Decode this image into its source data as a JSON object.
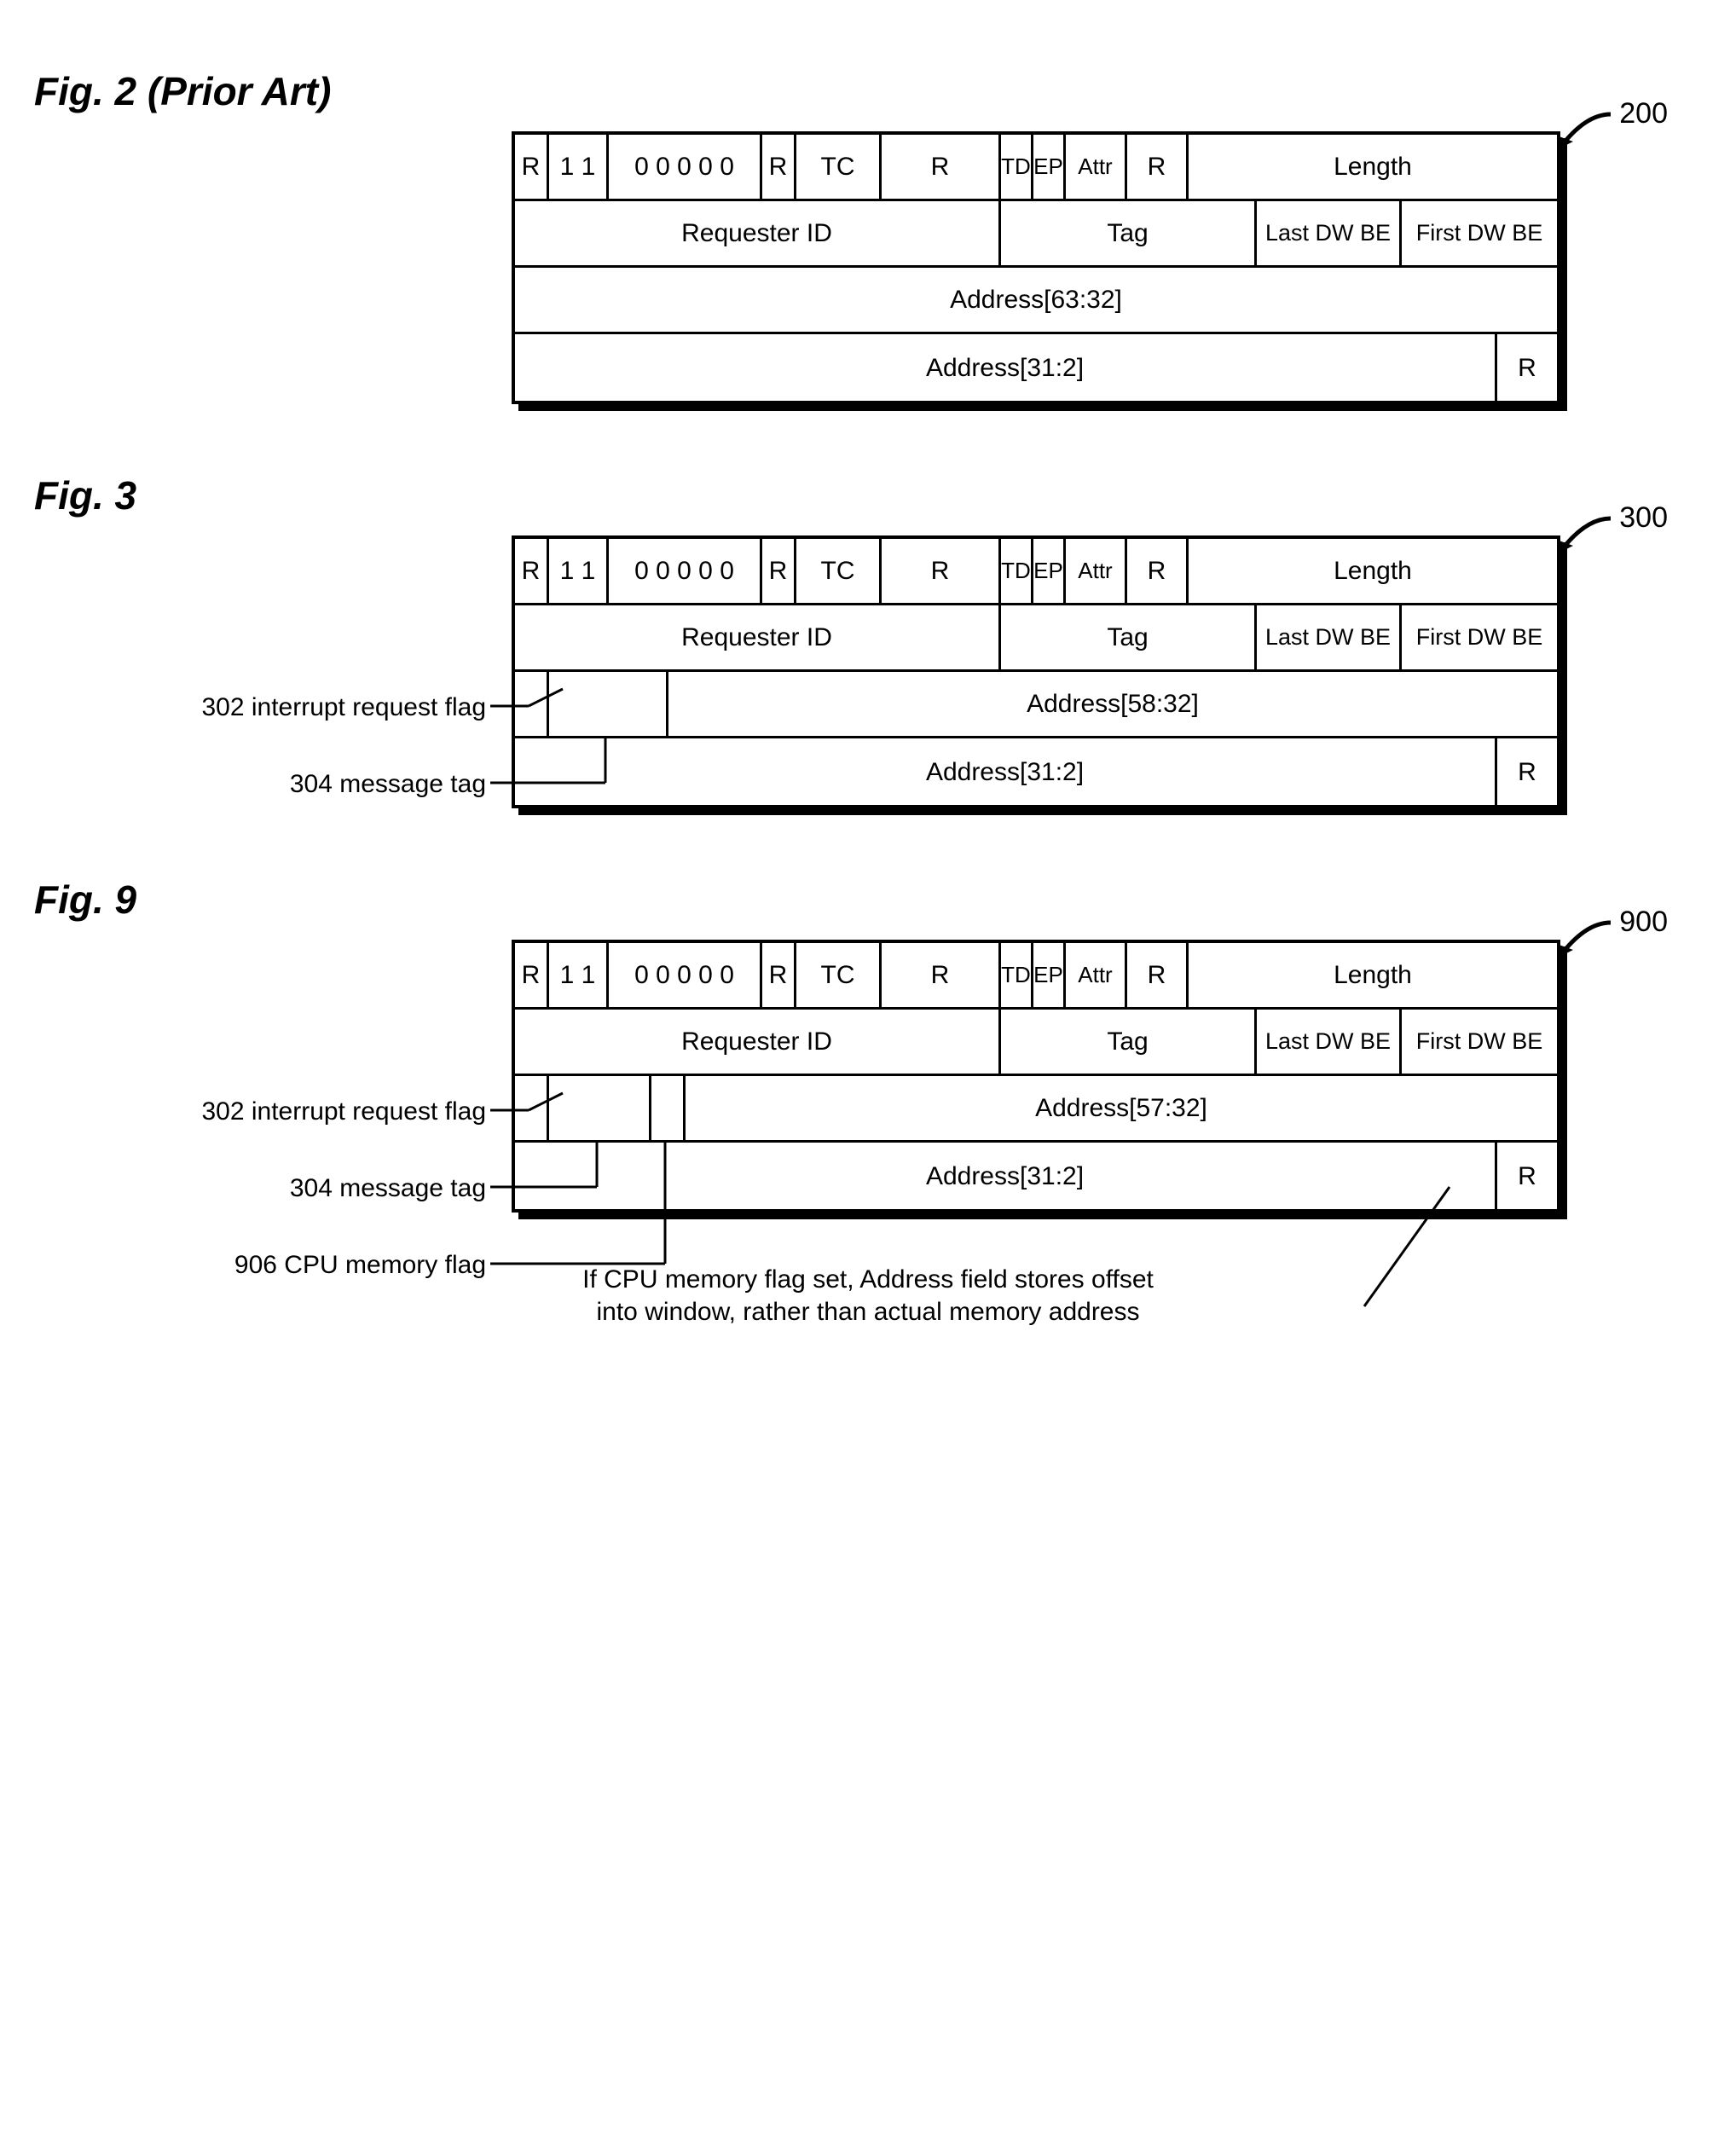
{
  "figures": {
    "fig2": {
      "title": "Fig. 2 (Prior Art)",
      "ref": "200"
    },
    "fig3": {
      "title": "Fig. 3",
      "ref": "300"
    },
    "fig9": {
      "title": "Fig. 9",
      "ref": "900"
    }
  },
  "header_row1": {
    "r1": "R",
    "fmt_hi": "1 1",
    "typebits": "0 0 0 0 0",
    "r2": "R",
    "tc": "TC",
    "r3": "R",
    "td": "TD",
    "ep": "EP",
    "attr": "Attr",
    "r4": "R",
    "len": "Length"
  },
  "header_row2": {
    "reqid": "Requester ID",
    "tag": "Tag",
    "lastbe": "Last DW BE",
    "firstbe": "First DW BE"
  },
  "fig2_rows": {
    "addr_hi": "Address[63:32]",
    "addr_lo": "Address[31:2]",
    "r": "R"
  },
  "fig3_rows": {
    "addr_hi": "Address[58:32]",
    "addr_lo": "Address[31:2]",
    "r": "R"
  },
  "fig9_rows": {
    "addr_hi": "Address[57:32]",
    "addr_lo": "Address[31:2]",
    "r": "R"
  },
  "callouts": {
    "c302": "302 interrupt request flag",
    "c304": "304  message tag",
    "c906": "906 CPU memory flag"
  },
  "footnote": {
    "l1": "If CPU memory flag set, Address field stores offset",
    "l2": "into window, rather than actual memory address"
  }
}
